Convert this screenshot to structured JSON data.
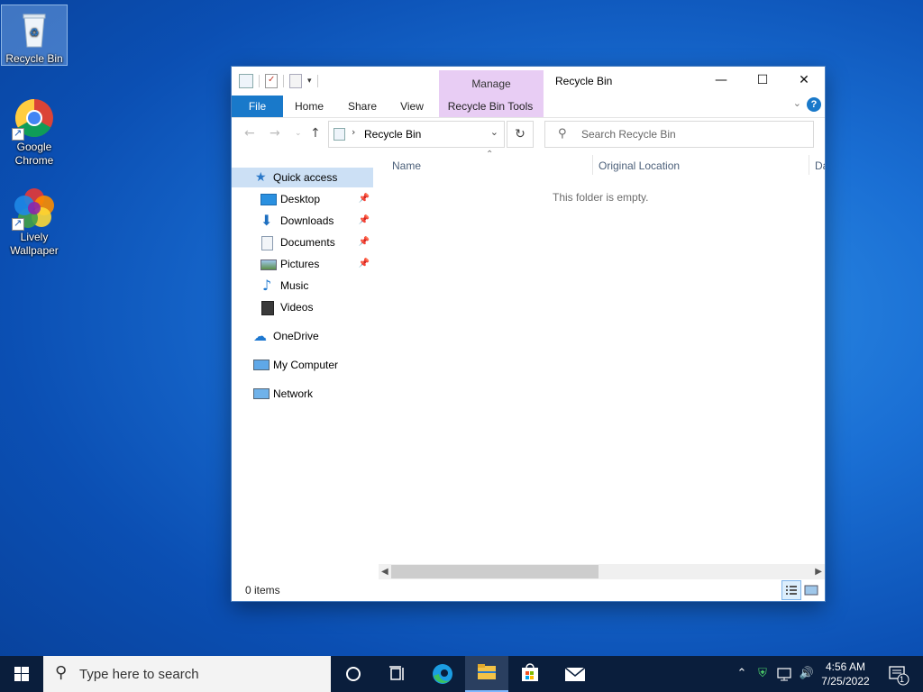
{
  "desktop": {
    "icons": [
      {
        "label": "Recycle Bin",
        "icon": "recycle-bin-icon"
      },
      {
        "label": "Google Chrome",
        "icon": "chrome-icon"
      },
      {
        "label": "Lively Wallpaper",
        "icon": "lively-wallpaper-icon"
      }
    ]
  },
  "window": {
    "title": "Recycle Bin",
    "manage_tab": "Manage",
    "ribbon_tabs": [
      "File",
      "Home",
      "Share",
      "View",
      "Recycle Bin Tools"
    ],
    "address": {
      "path": "Recycle Bin"
    },
    "search": {
      "placeholder": "Search Recycle Bin"
    },
    "nav": {
      "quick_access": "Quick access",
      "items": [
        "Desktop",
        "Downloads",
        "Documents",
        "Pictures",
        "Music",
        "Videos"
      ],
      "onedrive": "OneDrive",
      "my_computer": "My Computer",
      "network": "Network"
    },
    "columns": [
      "Name",
      "Original Location",
      "Da"
    ],
    "empty_message": "This folder is empty.",
    "status": "0 items"
  },
  "taskbar": {
    "search_placeholder": "Type here to search",
    "time": "4:56 AM",
    "date": "7/25/2022",
    "notification_count": "1"
  },
  "colors": {
    "accent": "#1979ca",
    "manage_tab": "#e8cdf4",
    "selection": "#cce0f5"
  }
}
